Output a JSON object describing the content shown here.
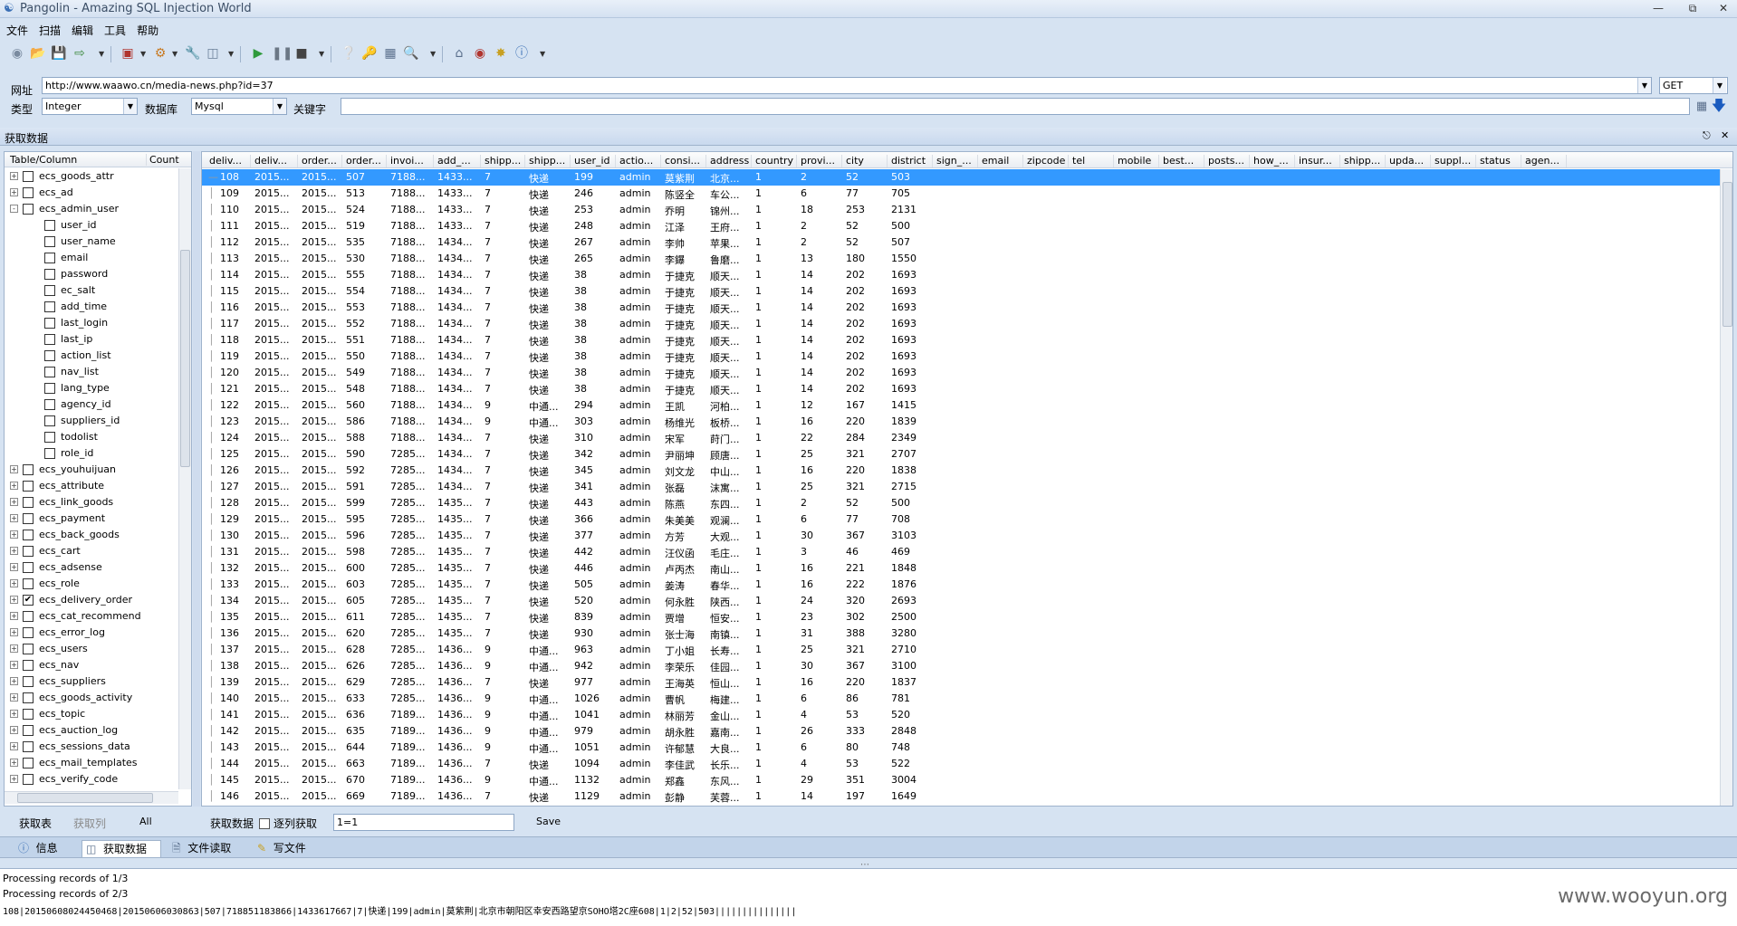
{
  "window": {
    "title": "Pangolin - Amazing SQL Injection World"
  },
  "menu": [
    "文件",
    "扫描",
    "编辑",
    "工具",
    "帮助"
  ],
  "toolbar_icons": [
    "new-icon",
    "open-icon",
    "save-icon",
    "export-icon",
    "import-icon",
    "settings-icon",
    "tools-icon",
    "database-icon",
    "play-icon",
    "pause-icon",
    "stop-icon",
    "help-icon",
    "key-icon",
    "network-icon",
    "search-icon",
    "home-icon",
    "bug-icon",
    "plugin-icon",
    "info-icon"
  ],
  "url_row": {
    "url_label": "网址",
    "url_value": "http://www.waawo.cn/media-news.php?id=37",
    "method": "GET",
    "type_label": "类型",
    "type_value": "Integer",
    "db_label": "数据库",
    "db_value": "Mysql",
    "keyword_label": "关键字",
    "keyword_value": ""
  },
  "panel": {
    "title": "获取数据",
    "pin": "ⷻ",
    "close": "✕"
  },
  "tree": {
    "col_table": "Table/Column",
    "col_count": "Count",
    "items": [
      {
        "label": "ecs_goods_attr",
        "level": 0,
        "exp": "+",
        "checked": false
      },
      {
        "label": "ecs_ad",
        "level": 0,
        "exp": "+",
        "checked": false
      },
      {
        "label": "ecs_admin_user",
        "level": 0,
        "exp": "-",
        "checked": false
      },
      {
        "label": "user_id",
        "level": 1,
        "checked": false
      },
      {
        "label": "user_name",
        "level": 1,
        "checked": false
      },
      {
        "label": "email",
        "level": 1,
        "checked": false
      },
      {
        "label": "password",
        "level": 1,
        "checked": false
      },
      {
        "label": "ec_salt",
        "level": 1,
        "checked": false
      },
      {
        "label": "add_time",
        "level": 1,
        "checked": false
      },
      {
        "label": "last_login",
        "level": 1,
        "checked": false
      },
      {
        "label": "last_ip",
        "level": 1,
        "checked": false
      },
      {
        "label": "action_list",
        "level": 1,
        "checked": false
      },
      {
        "label": "nav_list",
        "level": 1,
        "checked": false
      },
      {
        "label": "lang_type",
        "level": 1,
        "checked": false
      },
      {
        "label": "agency_id",
        "level": 1,
        "checked": false
      },
      {
        "label": "suppliers_id",
        "level": 1,
        "checked": false
      },
      {
        "label": "todolist",
        "level": 1,
        "checked": false
      },
      {
        "label": "role_id",
        "level": 1,
        "checked": false
      },
      {
        "label": "ecs_youhuijuan",
        "level": 0,
        "exp": "+",
        "checked": false
      },
      {
        "label": "ecs_attribute",
        "level": 0,
        "exp": "+",
        "checked": false
      },
      {
        "label": "ecs_link_goods",
        "level": 0,
        "exp": "+",
        "checked": false
      },
      {
        "label": "ecs_payment",
        "level": 0,
        "exp": "+",
        "checked": false
      },
      {
        "label": "ecs_back_goods",
        "level": 0,
        "exp": "+",
        "checked": false
      },
      {
        "label": "ecs_cart",
        "level": 0,
        "exp": "+",
        "checked": false
      },
      {
        "label": "ecs_adsense",
        "level": 0,
        "exp": "+",
        "checked": false
      },
      {
        "label": "ecs_role",
        "level": 0,
        "exp": "+",
        "checked": false
      },
      {
        "label": "ecs_delivery_order",
        "level": 0,
        "exp": "+",
        "checked": true
      },
      {
        "label": "ecs_cat_recommend",
        "level": 0,
        "exp": "+",
        "checked": false
      },
      {
        "label": "ecs_error_log",
        "level": 0,
        "exp": "+",
        "checked": false
      },
      {
        "label": "ecs_users",
        "level": 0,
        "exp": "+",
        "checked": false
      },
      {
        "label": "ecs_nav",
        "level": 0,
        "exp": "+",
        "checked": false
      },
      {
        "label": "ecs_suppliers",
        "level": 0,
        "exp": "+",
        "checked": false
      },
      {
        "label": "ecs_goods_activity",
        "level": 0,
        "exp": "+",
        "checked": false
      },
      {
        "label": "ecs_topic",
        "level": 0,
        "exp": "+",
        "checked": false
      },
      {
        "label": "ecs_auction_log",
        "level": 0,
        "exp": "+",
        "checked": false
      },
      {
        "label": "ecs_sessions_data",
        "level": 0,
        "exp": "+",
        "checked": false
      },
      {
        "label": "ecs_mail_templates",
        "level": 0,
        "exp": "+",
        "checked": false
      },
      {
        "label": "ecs_verify_code",
        "level": 0,
        "exp": "+",
        "checked": false
      }
    ]
  },
  "grid": {
    "columns": [
      "deliv...",
      "deliv...",
      "order...",
      "order...",
      "invoi...",
      "add_...",
      "shipp...",
      "shipp...",
      "user_id",
      "actio...",
      "consi...",
      "address",
      "country",
      "provi...",
      "city",
      "district",
      "sign_...",
      "email",
      "zipcode",
      "tel",
      "mobile",
      "best...",
      "posts...",
      "how_...",
      "insur...",
      "shipp...",
      "upda...",
      "suppl...",
      "status",
      "agen..."
    ],
    "rows": [
      [
        "108",
        "2015...",
        "2015...",
        "507",
        "7188...",
        "1433...",
        "7",
        "快递",
        "199",
        "admin",
        "莫紫荆",
        "北京...",
        "1",
        "2",
        "52",
        "503"
      ],
      [
        "109",
        "2015...",
        "2015...",
        "513",
        "7188...",
        "1433...",
        "7",
        "快递",
        "246",
        "admin",
        "陈竖全",
        "车公...",
        "1",
        "6",
        "77",
        "705"
      ],
      [
        "110",
        "2015...",
        "2015...",
        "524",
        "7188...",
        "1433...",
        "7",
        "快递",
        "253",
        "admin",
        "乔明",
        "锦州...",
        "1",
        "18",
        "253",
        "2131"
      ],
      [
        "111",
        "2015...",
        "2015...",
        "519",
        "7188...",
        "1433...",
        "7",
        "快递",
        "248",
        "admin",
        "江泽",
        "王府...",
        "1",
        "2",
        "52",
        "500"
      ],
      [
        "112",
        "2015...",
        "2015...",
        "535",
        "7188...",
        "1434...",
        "7",
        "快递",
        "267",
        "admin",
        "李帅",
        "苹果...",
        "1",
        "2",
        "52",
        "507"
      ],
      [
        "113",
        "2015...",
        "2015...",
        "530",
        "7188...",
        "1434...",
        "7",
        "快递",
        "265",
        "admin",
        "李鑤",
        "鲁磨...",
        "1",
        "13",
        "180",
        "1550"
      ],
      [
        "114",
        "2015...",
        "2015...",
        "555",
        "7188...",
        "1434...",
        "7",
        "快递",
        "38",
        "admin",
        "于捷克",
        "顺天...",
        "1",
        "14",
        "202",
        "1693"
      ],
      [
        "115",
        "2015...",
        "2015...",
        "554",
        "7188...",
        "1434...",
        "7",
        "快递",
        "38",
        "admin",
        "于捷克",
        "顺天...",
        "1",
        "14",
        "202",
        "1693"
      ],
      [
        "116",
        "2015...",
        "2015...",
        "553",
        "7188...",
        "1434...",
        "7",
        "快递",
        "38",
        "admin",
        "于捷克",
        "顺天...",
        "1",
        "14",
        "202",
        "1693"
      ],
      [
        "117",
        "2015...",
        "2015...",
        "552",
        "7188...",
        "1434...",
        "7",
        "快递",
        "38",
        "admin",
        "于捷克",
        "顺天...",
        "1",
        "14",
        "202",
        "1693"
      ],
      [
        "118",
        "2015...",
        "2015...",
        "551",
        "7188...",
        "1434...",
        "7",
        "快递",
        "38",
        "admin",
        "于捷克",
        "顺天...",
        "1",
        "14",
        "202",
        "1693"
      ],
      [
        "119",
        "2015...",
        "2015...",
        "550",
        "7188...",
        "1434...",
        "7",
        "快递",
        "38",
        "admin",
        "于捷克",
        "顺天...",
        "1",
        "14",
        "202",
        "1693"
      ],
      [
        "120",
        "2015...",
        "2015...",
        "549",
        "7188...",
        "1434...",
        "7",
        "快递",
        "38",
        "admin",
        "于捷克",
        "顺天...",
        "1",
        "14",
        "202",
        "1693"
      ],
      [
        "121",
        "2015...",
        "2015...",
        "548",
        "7188...",
        "1434...",
        "7",
        "快递",
        "38",
        "admin",
        "于捷克",
        "顺天...",
        "1",
        "14",
        "202",
        "1693"
      ],
      [
        "122",
        "2015...",
        "2015...",
        "560",
        "7188...",
        "1434...",
        "9",
        "中通...",
        "294",
        "admin",
        "王凯",
        "河柏...",
        "1",
        "12",
        "167",
        "1415"
      ],
      [
        "123",
        "2015...",
        "2015...",
        "586",
        "7188...",
        "1434...",
        "9",
        "中通...",
        "303",
        "admin",
        "杨维光",
        "板桥...",
        "1",
        "16",
        "220",
        "1839"
      ],
      [
        "124",
        "2015...",
        "2015...",
        "588",
        "7188...",
        "1434...",
        "7",
        "快递",
        "310",
        "admin",
        "宋军",
        "莳门...",
        "1",
        "22",
        "284",
        "2349"
      ],
      [
        "125",
        "2015...",
        "2015...",
        "590",
        "7285...",
        "1434...",
        "7",
        "快递",
        "342",
        "admin",
        "尹丽坤",
        "顾唐...",
        "1",
        "25",
        "321",
        "2707"
      ],
      [
        "126",
        "2015...",
        "2015...",
        "592",
        "7285...",
        "1434...",
        "7",
        "快递",
        "345",
        "admin",
        "刘文龙",
        "中山...",
        "1",
        "16",
        "220",
        "1838"
      ],
      [
        "127",
        "2015...",
        "2015...",
        "591",
        "7285...",
        "1434...",
        "7",
        "快递",
        "341",
        "admin",
        "张磊",
        "沫寓...",
        "1",
        "25",
        "321",
        "2715"
      ],
      [
        "128",
        "2015...",
        "2015...",
        "599",
        "7285...",
        "1435...",
        "7",
        "快递",
        "443",
        "admin",
        "陈燕",
        "东四...",
        "1",
        "2",
        "52",
        "500"
      ],
      [
        "129",
        "2015...",
        "2015...",
        "595",
        "7285...",
        "1435...",
        "7",
        "快递",
        "366",
        "admin",
        "朱美美",
        "观澜...",
        "1",
        "6",
        "77",
        "708"
      ],
      [
        "130",
        "2015...",
        "2015...",
        "596",
        "7285...",
        "1435...",
        "7",
        "快递",
        "377",
        "admin",
        "方芳",
        "大观...",
        "1",
        "30",
        "367",
        "3103"
      ],
      [
        "131",
        "2015...",
        "2015...",
        "598",
        "7285...",
        "1435...",
        "7",
        "快递",
        "442",
        "admin",
        "汪仪函",
        "毛庄...",
        "1",
        "3",
        "46",
        "469"
      ],
      [
        "132",
        "2015...",
        "2015...",
        "600",
        "7285...",
        "1435...",
        "7",
        "快递",
        "446",
        "admin",
        "卢丙杰",
        "南山...",
        "1",
        "16",
        "221",
        "1848"
      ],
      [
        "133",
        "2015...",
        "2015...",
        "603",
        "7285...",
        "1435...",
        "7",
        "快递",
        "505",
        "admin",
        "姜涛",
        "春华...",
        "1",
        "16",
        "222",
        "1876"
      ],
      [
        "134",
        "2015...",
        "2015...",
        "605",
        "7285...",
        "1435...",
        "7",
        "快递",
        "520",
        "admin",
        "何永胜",
        "陕西...",
        "1",
        "24",
        "320",
        "2693"
      ],
      [
        "135",
        "2015...",
        "2015...",
        "611",
        "7285...",
        "1435...",
        "7",
        "快递",
        "839",
        "admin",
        "贾增",
        "恒安...",
        "1",
        "23",
        "302",
        "2500"
      ],
      [
        "136",
        "2015...",
        "2015...",
        "620",
        "7285...",
        "1435...",
        "7",
        "快递",
        "930",
        "admin",
        "张士海",
        "南镇...",
        "1",
        "31",
        "388",
        "3280"
      ],
      [
        "137",
        "2015...",
        "2015...",
        "628",
        "7285...",
        "1436...",
        "9",
        "中通...",
        "963",
        "admin",
        "丁小姐",
        "长寿...",
        "1",
        "25",
        "321",
        "2710"
      ],
      [
        "138",
        "2015...",
        "2015...",
        "626",
        "7285...",
        "1436...",
        "9",
        "中通...",
        "942",
        "admin",
        "李荣乐",
        "佳园...",
        "1",
        "30",
        "367",
        "3100"
      ],
      [
        "139",
        "2015...",
        "2015...",
        "629",
        "7285...",
        "1436...",
        "7",
        "快递",
        "977",
        "admin",
        "王海英",
        "恒山...",
        "1",
        "16",
        "220",
        "1837"
      ],
      [
        "140",
        "2015...",
        "2015...",
        "633",
        "7285...",
        "1436...",
        "9",
        "中通...",
        "1026",
        "admin",
        "曹帆",
        "梅建...",
        "1",
        "6",
        "86",
        "781"
      ],
      [
        "141",
        "2015...",
        "2015...",
        "636",
        "7189...",
        "1436...",
        "9",
        "中通...",
        "1041",
        "admin",
        "林丽芳",
        "金山...",
        "1",
        "4",
        "53",
        "520"
      ],
      [
        "142",
        "2015...",
        "2015...",
        "635",
        "7189...",
        "1436...",
        "9",
        "中通...",
        "979",
        "admin",
        "胡永胜",
        "嘉南...",
        "1",
        "26",
        "333",
        "2848"
      ],
      [
        "143",
        "2015...",
        "2015...",
        "644",
        "7189...",
        "1436...",
        "9",
        "中通...",
        "1051",
        "admin",
        "许郁慧",
        "大良...",
        "1",
        "6",
        "80",
        "748"
      ],
      [
        "144",
        "2015...",
        "2015...",
        "663",
        "7189...",
        "1436...",
        "7",
        "快递",
        "1094",
        "admin",
        "李佳武",
        "长乐...",
        "1",
        "4",
        "53",
        "522"
      ],
      [
        "145",
        "2015...",
        "2015...",
        "670",
        "7189...",
        "1436...",
        "9",
        "中通...",
        "1132",
        "admin",
        "郑鑫",
        "东风...",
        "1",
        "29",
        "351",
        "3004"
      ],
      [
        "146",
        "2015...",
        "2015...",
        "669",
        "7189...",
        "1436...",
        "7",
        "快递",
        "1129",
        "admin",
        "彭静",
        "芙蓉...",
        "1",
        "14",
        "197",
        "1649"
      ]
    ]
  },
  "left_actions": {
    "get_table": "获取表",
    "get_column": "获取列",
    "all": "All"
  },
  "grid_actions": {
    "get_data": "获取数据",
    "row_by_row": "逐列获取",
    "condition": "1=1",
    "save": "Save"
  },
  "tabs": [
    {
      "label": "信息",
      "icon": "info-icon"
    },
    {
      "label": "获取数据",
      "icon": "database-icon",
      "active": true
    },
    {
      "label": "文件读取",
      "icon": "file-icon"
    },
    {
      "label": "写文件",
      "icon": "write-file-icon"
    }
  ],
  "log": [
    "Processing records of 1/3",
    "Processing records of 2/3",
    "108|20150608024450468|20150606030863|507|718851183866|1433617667|7|快递|199|admin|莫紫荆|北京市朝阳区幸安西路望京SOHO塔2C座608|1|2|52|503|||||||||||||||"
  ],
  "watermark": "www.wooyun.org"
}
